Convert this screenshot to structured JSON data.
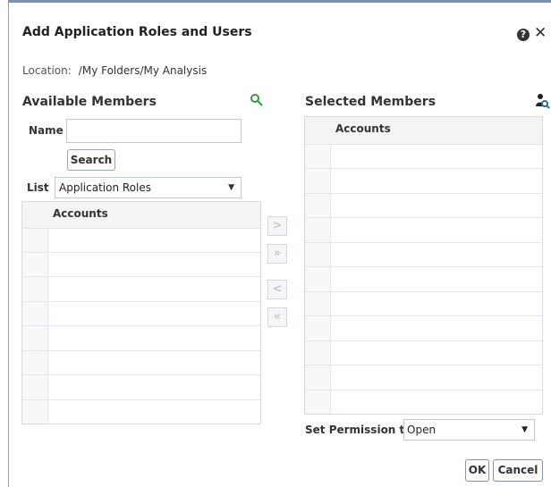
{
  "dialog": {
    "title": "Add Application Roles and Users",
    "help_icon": "question-circle-icon",
    "close_icon": "close-icon"
  },
  "location": {
    "label": "Location:",
    "value": "/My Folders/My Analysis"
  },
  "available": {
    "title": "Available Members",
    "search_icon": "search-icon",
    "name_label": "Name",
    "name_value": "",
    "search_button": "Search",
    "list_label": "List",
    "list_value": "Application Roles",
    "table_header": "Accounts",
    "rows": [
      "",
      "",
      "",
      "",
      "",
      "",
      "",
      ""
    ]
  },
  "move_buttons": {
    "move": ">",
    "move_all": "»",
    "remove": "<",
    "remove_all": "«"
  },
  "selected": {
    "title": "Selected Members",
    "user_icon": "user-search-icon",
    "table_header": "Accounts",
    "rows": [
      "",
      "",
      "",
      "",
      "",
      "",
      "",
      "",
      "",
      "",
      ""
    ],
    "permission_label": "Set Permission to",
    "permission_value": "Open"
  },
  "footer": {
    "ok": "OK",
    "cancel": "Cancel"
  }
}
